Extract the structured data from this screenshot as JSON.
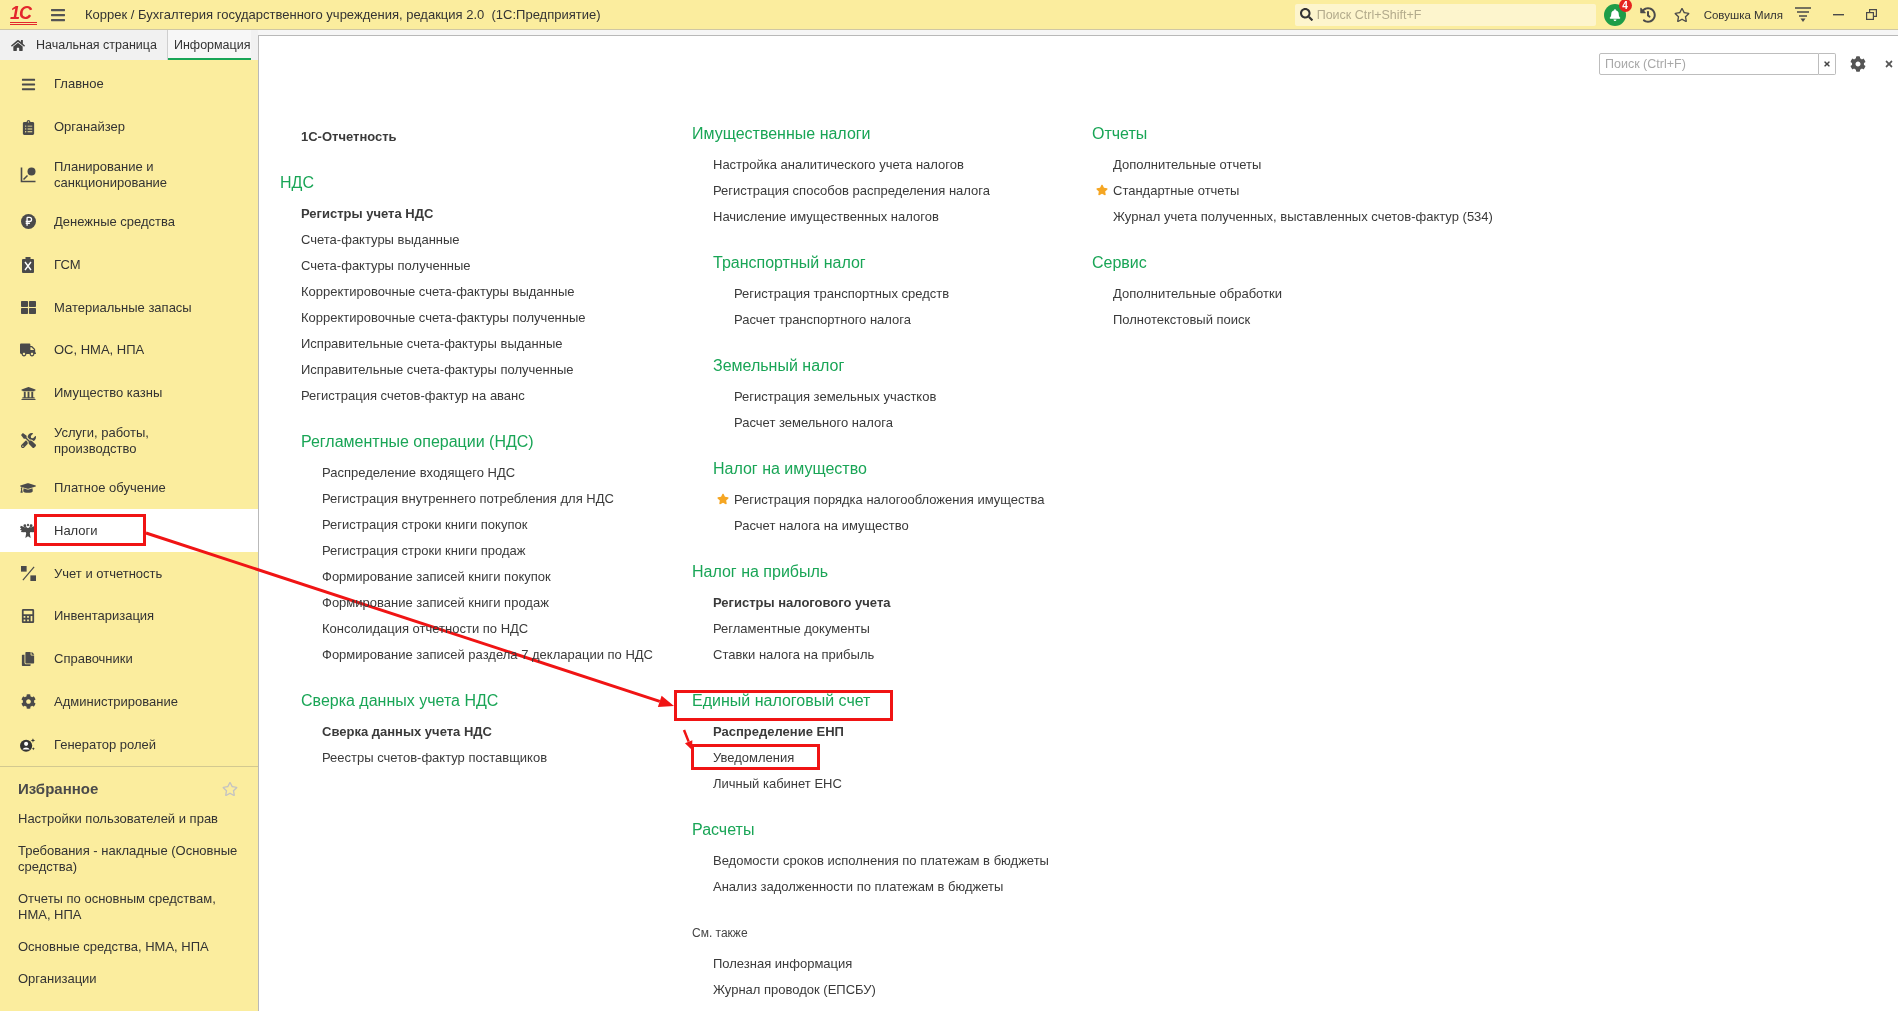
{
  "title_bar": {
    "logo": "1С",
    "title": "Коррек / Бухгалтерия государственного учреждения, редакция 2.0  (1С:Предприятие)",
    "search": {
      "placeholder": "Поиск Ctrl+Shift+F"
    },
    "notification_count": "4",
    "user": "Совушка Миля"
  },
  "tabs": [
    {
      "kind": "home",
      "label": "Начальная страница",
      "selected": false
    },
    {
      "kind": "page",
      "label": "Информация",
      "selected": true
    }
  ],
  "sidebar": {
    "items": [
      {
        "label": "Главное",
        "selected": false,
        "marked": false
      },
      {
        "label": "Органайзер",
        "selected": false,
        "marked": false
      },
      {
        "label": "Планирование и санкционирование",
        "selected": false,
        "marked": false
      },
      {
        "label": "Денежные средства",
        "selected": false,
        "marked": false
      },
      {
        "label": "ГСМ",
        "selected": false,
        "marked": false
      },
      {
        "label": "Материальные запасы",
        "selected": false,
        "marked": false
      },
      {
        "label": "ОС, НМА, НПА",
        "selected": false,
        "marked": false
      },
      {
        "label": "Имущество казны",
        "selected": false,
        "marked": false
      },
      {
        "label": "Услуги, работы, производство",
        "selected": false,
        "marked": false
      },
      {
        "label": "Платное обучение",
        "selected": false,
        "marked": false
      },
      {
        "label": "Налоги",
        "selected": true,
        "marked": true
      },
      {
        "label": "Учет и отчетность",
        "selected": false,
        "marked": false
      },
      {
        "label": "Инвентаризация",
        "selected": false,
        "marked": false
      },
      {
        "label": "Справочники",
        "selected": false,
        "marked": false
      },
      {
        "label": "Администрирование",
        "selected": false,
        "marked": false
      },
      {
        "label": "Генератор ролей",
        "selected": false,
        "marked": false
      }
    ],
    "favorites": {
      "title": "Избранное",
      "items": [
        "Настройки пользователей и прав",
        "Требования - накладные (Основные средства)",
        "Отчеты по основным средствам, НМА, НПА",
        "Основные средства, НМА, НПА",
        "Организации"
      ]
    }
  },
  "panel": {
    "search": {
      "placeholder": "Поиск (Ctrl+F)"
    },
    "columns": [
      {
        "sections": [
          {
            "kind": "group",
            "marked": false,
            "items": [
              {
                "label": "1С-Отчетность",
                "bold": true,
                "starred": false,
                "marked": false
              }
            ]
          },
          {
            "kind": "group",
            "title": "НДС",
            "marked": false,
            "items": [
              {
                "label": "Регистры учета НДС",
                "bold": true,
                "starred": false,
                "marked": false
              },
              {
                "label": "Счета-фактуры выданные",
                "bold": false,
                "starred": false,
                "marked": false
              },
              {
                "label": "Счета-фактуры полученные",
                "bold": false,
                "starred": false,
                "marked": false
              },
              {
                "label": "Корректировочные счета-фактуры выданные",
                "bold": false,
                "starred": false,
                "marked": false
              },
              {
                "label": "Корректировочные счета-фактуры полученные",
                "bold": false,
                "starred": false,
                "marked": false
              },
              {
                "label": "Исправительные счета-фактуры выданные",
                "bold": false,
                "starred": false,
                "marked": false
              },
              {
                "label": "Исправительные счета-фактуры полученные",
                "bold": false,
                "starred": false,
                "marked": false
              },
              {
                "label": "Регистрация счетов-фактур на аванс",
                "bold": false,
                "starred": false,
                "marked": false
              }
            ],
            "children": [
              {
                "kind": "group",
                "title": "Регламентные операции (НДС)",
                "marked": false,
                "items": [
                  {
                    "label": "Распределение входящего НДС",
                    "bold": false,
                    "starred": false,
                    "marked": false
                  },
                  {
                    "label": "Регистрация внутреннего потребления для НДС",
                    "bold": false,
                    "starred": false,
                    "marked": false
                  },
                  {
                    "label": "Регистрация строки книги покупок",
                    "bold": false,
                    "starred": false,
                    "marked": false
                  },
                  {
                    "label": "Регистрация строки книги продаж",
                    "bold": false,
                    "starred": false,
                    "marked": false
                  },
                  {
                    "label": "Формирование записей книги покупок",
                    "bold": false,
                    "starred": false,
                    "marked": false
                  },
                  {
                    "label": "Формирование записей книги продаж",
                    "bold": false,
                    "starred": false,
                    "marked": false
                  },
                  {
                    "label": "Консолидация отчетности по НДС",
                    "bold": false,
                    "starred": false,
                    "marked": false
                  },
                  {
                    "label": "Формирование записей раздела 7 декларации по НДС",
                    "bold": false,
                    "starred": false,
                    "marked": false
                  }
                ]
              },
              {
                "kind": "group",
                "title": "Сверка данных учета НДС",
                "marked": false,
                "items": [
                  {
                    "label": "Сверка данных учета НДС",
                    "bold": true,
                    "starred": false,
                    "marked": false
                  },
                  {
                    "label": "Реестры счетов-фактур поставщиков",
                    "bold": false,
                    "starred": false,
                    "marked": false
                  }
                ]
              }
            ]
          }
        ]
      },
      {
        "sections": [
          {
            "kind": "group",
            "title": "Имущественные налоги",
            "marked": false,
            "items": [
              {
                "label": "Настройка аналитического учета налогов",
                "bold": false,
                "starred": false,
                "marked": false
              },
              {
                "label": "Регистрация способов распределения налога",
                "bold": false,
                "starred": false,
                "marked": false
              },
              {
                "label": "Начисление имущественных налогов",
                "bold": false,
                "starred": false,
                "marked": false
              }
            ],
            "children": [
              {
                "kind": "group",
                "title": "Транспортный налог",
                "marked": false,
                "items": [
                  {
                    "label": "Регистрация транспортных средств",
                    "bold": false,
                    "starred": false,
                    "marked": false
                  },
                  {
                    "label": "Расчет транспортного налога",
                    "bold": false,
                    "starred": false,
                    "marked": false
                  }
                ]
              },
              {
                "kind": "group",
                "title": "Земельный налог",
                "marked": false,
                "items": [
                  {
                    "label": "Регистрация земельных участков",
                    "bold": false,
                    "starred": false,
                    "marked": false
                  },
                  {
                    "label": "Расчет земельного налога",
                    "bold": false,
                    "starred": false,
                    "marked": false
                  }
                ]
              },
              {
                "kind": "group",
                "title": "Налог на имущество",
                "marked": false,
                "items": [
                  {
                    "label": "Регистрация порядка налогообложения имущества",
                    "bold": false,
                    "starred": true,
                    "marked": false
                  },
                  {
                    "label": "Расчет налога на имущество",
                    "bold": false,
                    "starred": false,
                    "marked": false
                  }
                ]
              }
            ]
          },
          {
            "kind": "group",
            "title": "Налог на прибыль",
            "marked": false,
            "items": [
              {
                "label": "Регистры налогового учета",
                "bold": true,
                "starred": false,
                "marked": false
              },
              {
                "label": "Регламентные документы",
                "bold": false,
                "starred": false,
                "marked": false
              },
              {
                "label": "Ставки налога на прибыль",
                "bold": false,
                "starred": false,
                "marked": false
              }
            ]
          },
          {
            "kind": "group",
            "title": "Единый налоговый счет",
            "marked": true,
            "items": [
              {
                "label": "Распределение ЕНП",
                "bold": true,
                "starred": false,
                "marked": false
              },
              {
                "label": "Уведомления",
                "bold": false,
                "starred": false,
                "marked": true
              },
              {
                "label": "Личный кабинет ЕНС",
                "bold": false,
                "starred": false,
                "marked": false
              }
            ]
          },
          {
            "kind": "group",
            "title": "Расчеты",
            "marked": false,
            "items": [
              {
                "label": "Ведомости сроков исполнения по платежам в бюджеты",
                "bold": false,
                "starred": false,
                "marked": false
              },
              {
                "label": "Анализ задолженности по платежам в бюджеты",
                "bold": false,
                "starred": false,
                "marked": false
              }
            ]
          },
          {
            "kind": "note",
            "title": "См. также",
            "marked": false,
            "items": [
              {
                "label": "Полезная информация",
                "bold": false,
                "starred": false,
                "marked": false
              },
              {
                "label": "Журнал проводок (ЕПСБУ)",
                "bold": false,
                "starred": false,
                "marked": false
              }
            ]
          }
        ]
      },
      {
        "sections": [
          {
            "kind": "group",
            "title": "Отчеты",
            "marked": false,
            "items": [
              {
                "label": "Дополнительные отчеты",
                "bold": false,
                "starred": false,
                "marked": false
              },
              {
                "label": "Стандартные отчеты",
                "bold": false,
                "starred": true,
                "marked": false
              },
              {
                "label": "Журнал учета полученных, выставленных счетов-фактур (534)",
                "bold": false,
                "starred": false,
                "marked": false
              }
            ]
          },
          {
            "kind": "group",
            "title": "Сервис",
            "marked": false,
            "items": [
              {
                "label": "Дополнительные обработки",
                "bold": false,
                "starred": false,
                "marked": false
              },
              {
                "label": "Полнотекстовый поиск",
                "bold": false,
                "starred": false,
                "marked": false
              }
            ]
          }
        ]
      }
    ]
  }
}
